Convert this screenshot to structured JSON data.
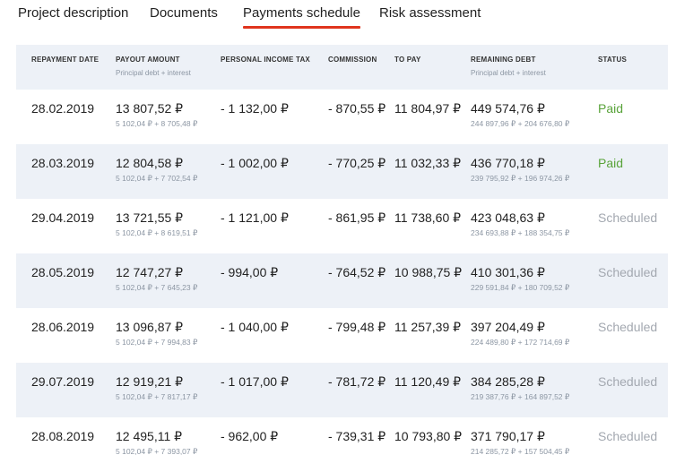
{
  "tabs": [
    {
      "label": "Project description",
      "active": false
    },
    {
      "label": "Documents",
      "active": false
    },
    {
      "label": "Payments schedule",
      "active": true
    },
    {
      "label": "Risk assessment",
      "active": false
    }
  ],
  "colors": {
    "accent": "#e0341e",
    "paid": "#59a33a",
    "scheduled": "#a3a8b0",
    "row_alt": "#edf1f7"
  },
  "table": {
    "headers": {
      "repayment_date": "REPAYMENT DATE",
      "payout_amount": "PAYOUT AMOUNT",
      "payout_amount_sub": "Principal debt + interest",
      "personal_income_tax": "PERSONAL INCOME TAX",
      "commission": "COMMISSION",
      "to_pay": "TO PAY",
      "remaining_debt": "REMAINING DEBT",
      "remaining_debt_sub": "Principal debt + interest",
      "status": "STATUS"
    },
    "rows": [
      {
        "date": "28.02.2019",
        "payout": "13 807,52 ₽",
        "payout_detail": "5 102,04 ₽ + 8 705,48 ₽",
        "tax": "- 1 132,00 ₽",
        "commission": "- 870,55 ₽",
        "to_pay": "11 804,97 ₽",
        "remaining": "449 574,76 ₽",
        "remaining_detail": "244 897,96 ₽ + 204 676,80 ₽",
        "status": "Paid"
      },
      {
        "date": "28.03.2019",
        "payout": "12 804,58 ₽",
        "payout_detail": "5 102,04 ₽ + 7 702,54 ₽",
        "tax": "- 1 002,00 ₽",
        "commission": "- 770,25 ₽",
        "to_pay": "11 032,33 ₽",
        "remaining": "436 770,18 ₽",
        "remaining_detail": "239 795,92 ₽ + 196 974,26 ₽",
        "status": "Paid"
      },
      {
        "date": "29.04.2019",
        "payout": "13 721,55 ₽",
        "payout_detail": "5 102,04 ₽ + 8 619,51 ₽",
        "tax": "- 1 121,00 ₽",
        "commission": "- 861,95 ₽",
        "to_pay": "11 738,60 ₽",
        "remaining": "423 048,63 ₽",
        "remaining_detail": "234 693,88 ₽ + 188 354,75 ₽",
        "status": "Scheduled"
      },
      {
        "date": "28.05.2019",
        "payout": "12 747,27 ₽",
        "payout_detail": "5 102,04 ₽ + 7 645,23 ₽",
        "tax": "- 994,00 ₽",
        "commission": "- 764,52 ₽",
        "to_pay": "10 988,75 ₽",
        "remaining": "410 301,36 ₽",
        "remaining_detail": "229 591,84 ₽ + 180 709,52 ₽",
        "status": "Scheduled"
      },
      {
        "date": "28.06.2019",
        "payout": "13 096,87 ₽",
        "payout_detail": "5 102,04 ₽ + 7 994,83 ₽",
        "tax": "- 1 040,00 ₽",
        "commission": "- 799,48 ₽",
        "to_pay": "11 257,39 ₽",
        "remaining": "397 204,49 ₽",
        "remaining_detail": "224 489,80 ₽ + 172 714,69 ₽",
        "status": "Scheduled"
      },
      {
        "date": "29.07.2019",
        "payout": "12 919,21 ₽",
        "payout_detail": "5 102,04 ₽ + 7 817,17 ₽",
        "tax": "- 1 017,00 ₽",
        "commission": "- 781,72 ₽",
        "to_pay": "11 120,49 ₽",
        "remaining": "384 285,28 ₽",
        "remaining_detail": "219 387,76 ₽ + 164 897,52 ₽",
        "status": "Scheduled"
      },
      {
        "date": "28.08.2019",
        "payout": "12 495,11 ₽",
        "payout_detail": "5 102,04 ₽ + 7 393,07 ₽",
        "tax": "- 962,00 ₽",
        "commission": "- 739,31 ₽",
        "to_pay": "10 793,80 ₽",
        "remaining": "371 790,17 ₽",
        "remaining_detail": "214 285,72 ₽ + 157 504,45 ₽",
        "status": "Scheduled"
      }
    ]
  }
}
